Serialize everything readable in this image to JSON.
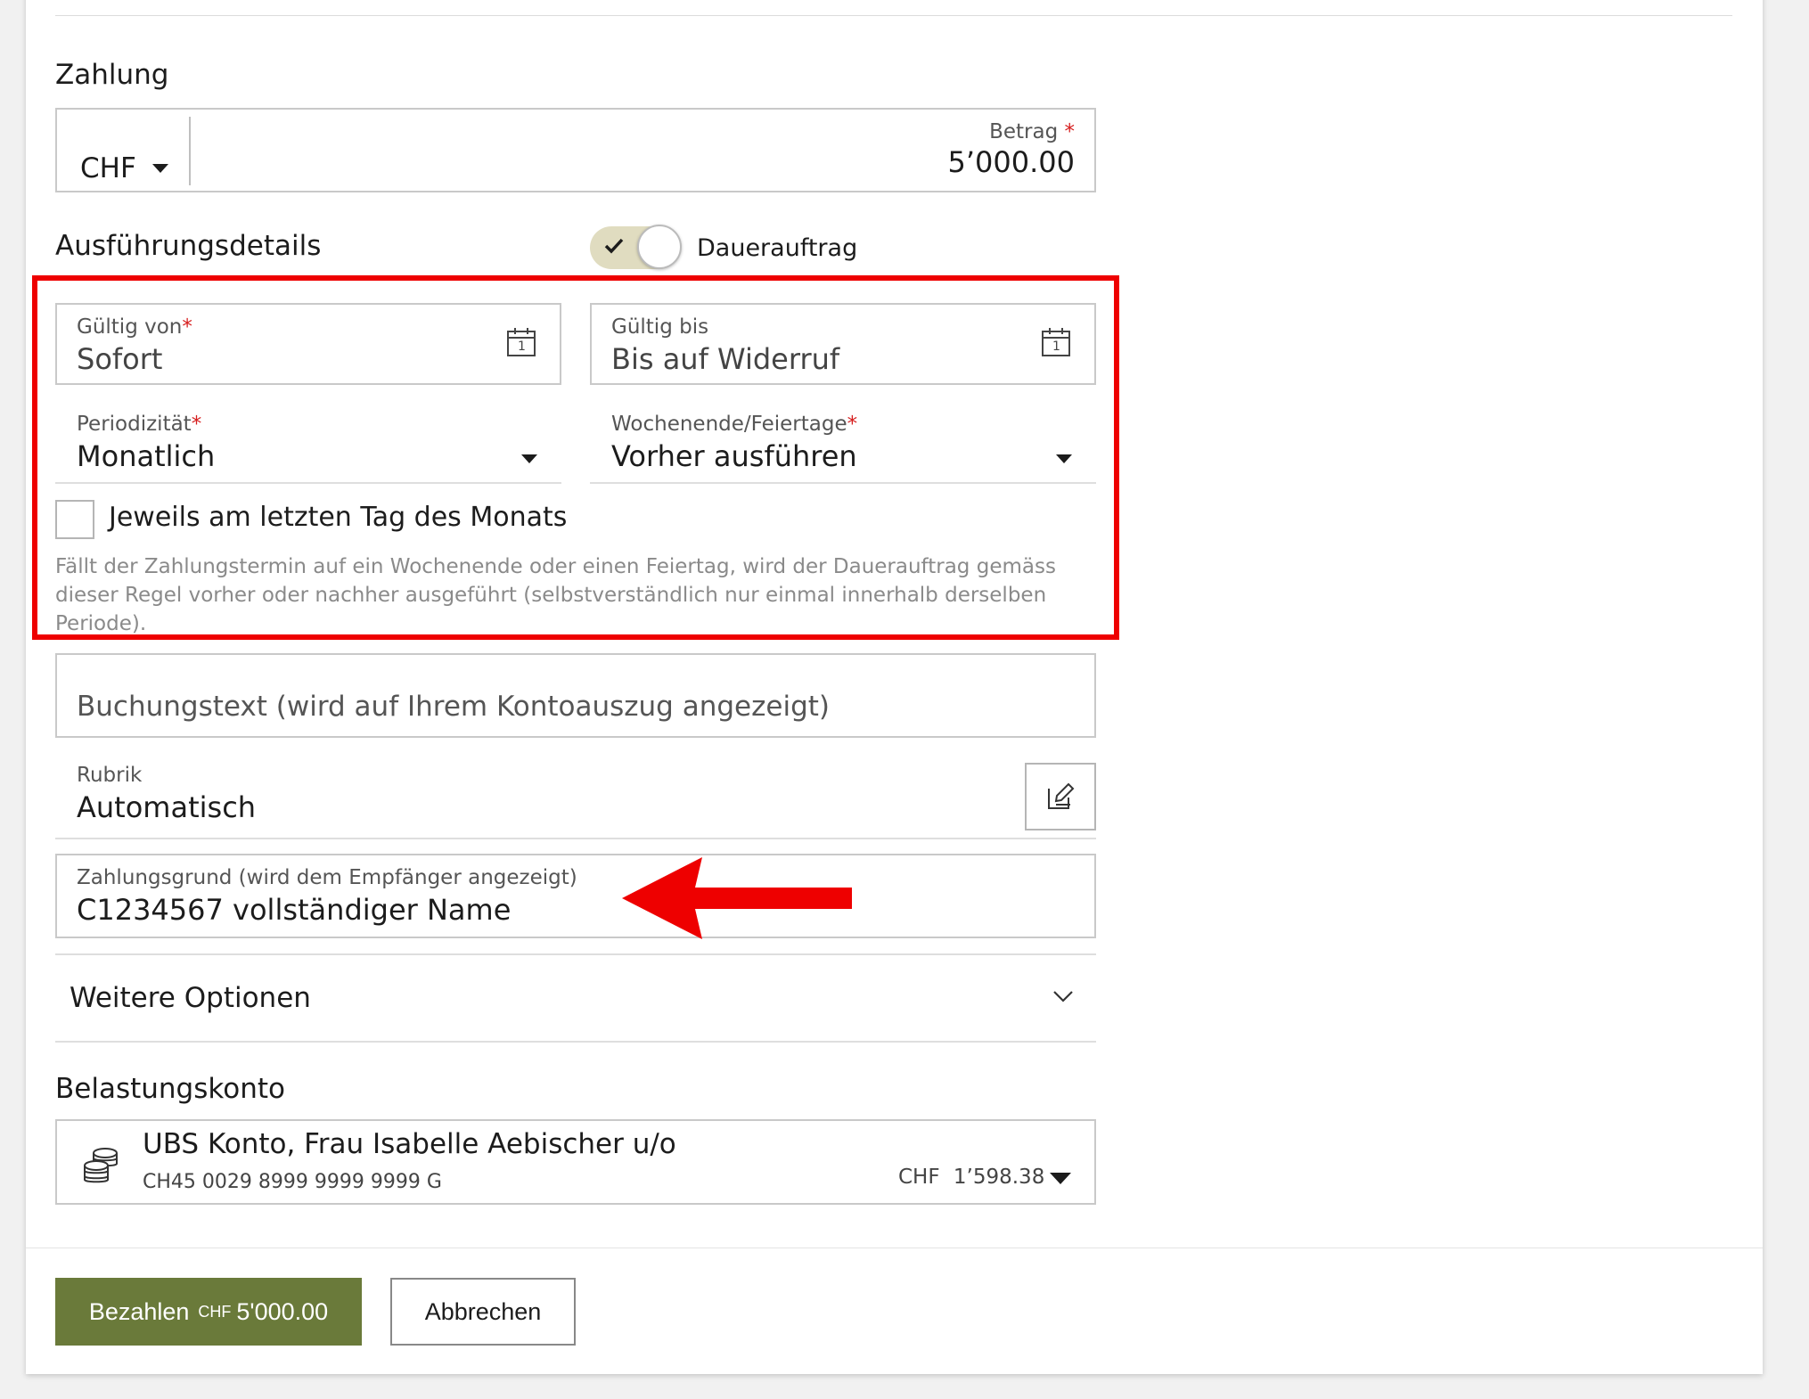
{
  "payment": {
    "section_title": "Zahlung",
    "currency": "CHF",
    "amount_label": "Betrag",
    "amount_required": "*",
    "amount_value": "5’000.00"
  },
  "execution": {
    "section_title": "Ausführungsdetails",
    "standing_order_label": "Dauerauftrag",
    "standing_order_enabled": true,
    "valid_from_label": "Gültig von",
    "valid_from_required": "*",
    "valid_from_value": "Sofort",
    "valid_to_label": "Gültig bis",
    "valid_to_value": "Bis auf Widerruf",
    "periodicity_label": "Periodizität",
    "periodicity_required": "*",
    "periodicity_value": "Monatlich",
    "weekend_label": "Wochenende/Feiertage",
    "weekend_required": "*",
    "weekend_value": "Vorher ausführen",
    "last_day_checkbox_label": "Jeweils am letzten Tag des Monats",
    "last_day_checked": false,
    "hint_line1": "Fällt der Zahlungstermin auf ein Wochenende oder einen Feiertag, wird der Dauerauftrag gemäss",
    "hint_line2": "dieser Regel vorher oder nachher ausgeführt (selbstverständlich nur einmal innerhalb derselben",
    "hint_line3": "Periode)."
  },
  "booking_text": {
    "placeholder": "Buchungstext (wird auf Ihrem Kontoauszug angezeigt)"
  },
  "rubric": {
    "label": "Rubrik",
    "value": "Automatisch"
  },
  "payment_reason": {
    "label": "Zahlungsgrund (wird dem Empfänger angezeigt)",
    "value": "C1234567 vollständiger Name"
  },
  "more_options": {
    "label": "Weitere Optionen"
  },
  "debit_account": {
    "section_title": "Belastungskonto",
    "name": "UBS Konto, Frau Isabelle Aebischer u/o",
    "iban": "CH45 0029 8999 9999 9999 G",
    "balance_currency": "CHF",
    "balance": "1’598.38"
  },
  "actions": {
    "pay_label": "Bezahlen",
    "pay_currency": "CHF",
    "pay_amount": "5'000.00",
    "cancel_label": "Abbrechen"
  },
  "icons": {
    "calendar_day": "1"
  },
  "colors": {
    "primary_button": "#6a7a3a",
    "toggle_track": "#e0dcc0",
    "required_star": "#d61e1e",
    "annotation_red": "#ee0000"
  }
}
